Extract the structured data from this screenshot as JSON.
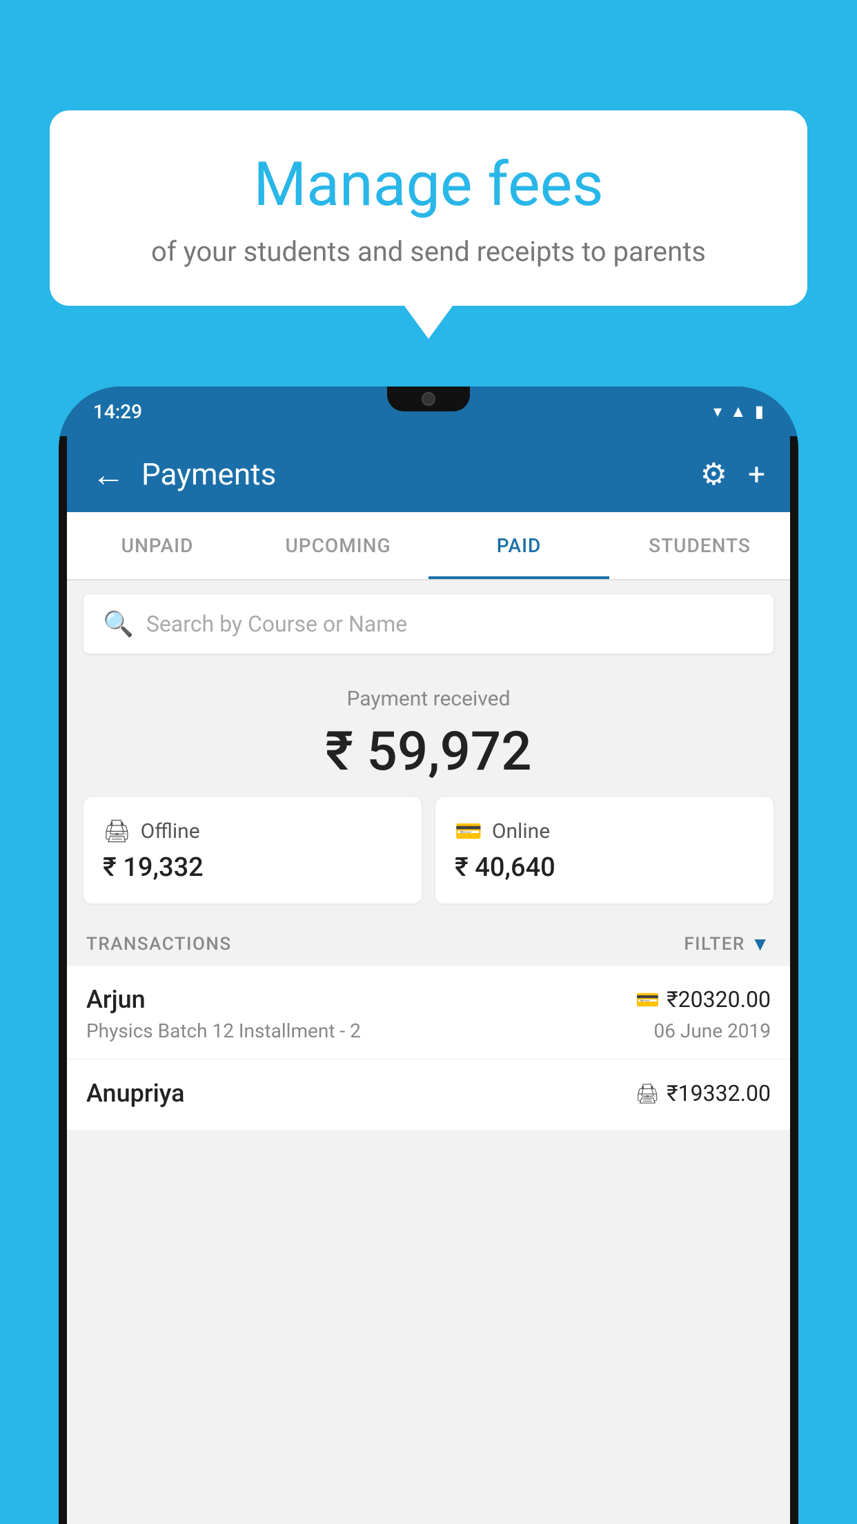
{
  "background_color": "#29b6e8",
  "speech_bubble": {
    "title": "Manage fees",
    "subtitle": "of your students and send receipts to parents"
  },
  "status_bar": {
    "time": "14:29",
    "icons": [
      "wifi",
      "signal",
      "battery"
    ]
  },
  "header": {
    "title": "Payments",
    "back_label": "←",
    "settings_label": "⚙",
    "add_label": "+"
  },
  "tabs": [
    {
      "label": "UNPAID",
      "active": false
    },
    {
      "label": "UPCOMING",
      "active": false
    },
    {
      "label": "PAID",
      "active": true
    },
    {
      "label": "STUDENTS",
      "active": false
    }
  ],
  "search": {
    "placeholder": "Search by Course or Name"
  },
  "payment_received": {
    "label": "Payment received",
    "amount": "₹ 59,972"
  },
  "payment_cards": [
    {
      "type": "Offline",
      "amount": "₹ 19,332",
      "icon": "offline"
    },
    {
      "type": "Online",
      "amount": "₹ 40,640",
      "icon": "online"
    }
  ],
  "transactions_section": {
    "label": "TRANSACTIONS",
    "filter_label": "FILTER"
  },
  "transactions": [
    {
      "name": "Arjun",
      "course": "Physics Batch 12 Installment - 2",
      "amount": "₹20320.00",
      "date": "06 June 2019",
      "payment_type": "online"
    },
    {
      "name": "Anupriya",
      "course": "",
      "amount": "₹19332.00",
      "date": "",
      "payment_type": "offline"
    }
  ]
}
